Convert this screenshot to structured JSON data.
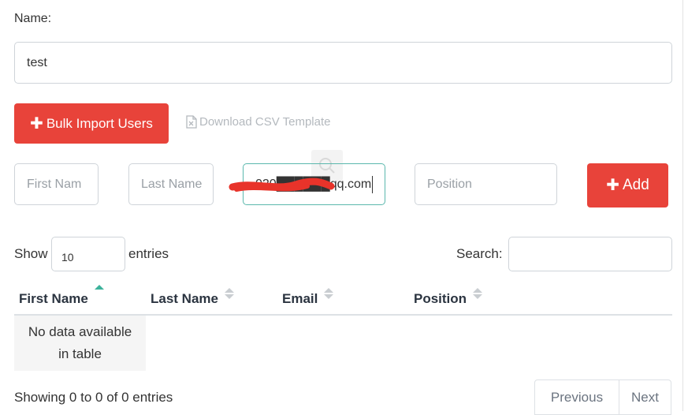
{
  "form": {
    "name_label": "Name:",
    "name_value": "test",
    "bulk_import_label": "Bulk Import Users",
    "download_template_label": "Download CSV Template",
    "first_name_placeholder": "First Nam",
    "last_name_placeholder": "Last Name",
    "email_value": "020██████qq.com",
    "position_placeholder": "Position",
    "add_label": "Add"
  },
  "table_controls": {
    "show_label": "Show",
    "entries_value": "10",
    "entries_label": "entries",
    "search_label": "Search:",
    "search_value": ""
  },
  "table": {
    "columns": [
      "First Name",
      "Last Name",
      "Email",
      "Position"
    ],
    "empty_message_line1": "No data available",
    "empty_message_line2": "in table"
  },
  "footer": {
    "info": "Showing 0 to 0 of 0 entries",
    "previous_label": "Previous",
    "next_label": "Next"
  },
  "colors": {
    "accent_red": "#e8433a",
    "sort_active": "#3cb29b",
    "focus_border": "#5bb8ad"
  },
  "icons": {
    "plus": "plus-icon",
    "csv": "csv-file-icon",
    "sort": "sort-icon",
    "search": "search-icon"
  }
}
